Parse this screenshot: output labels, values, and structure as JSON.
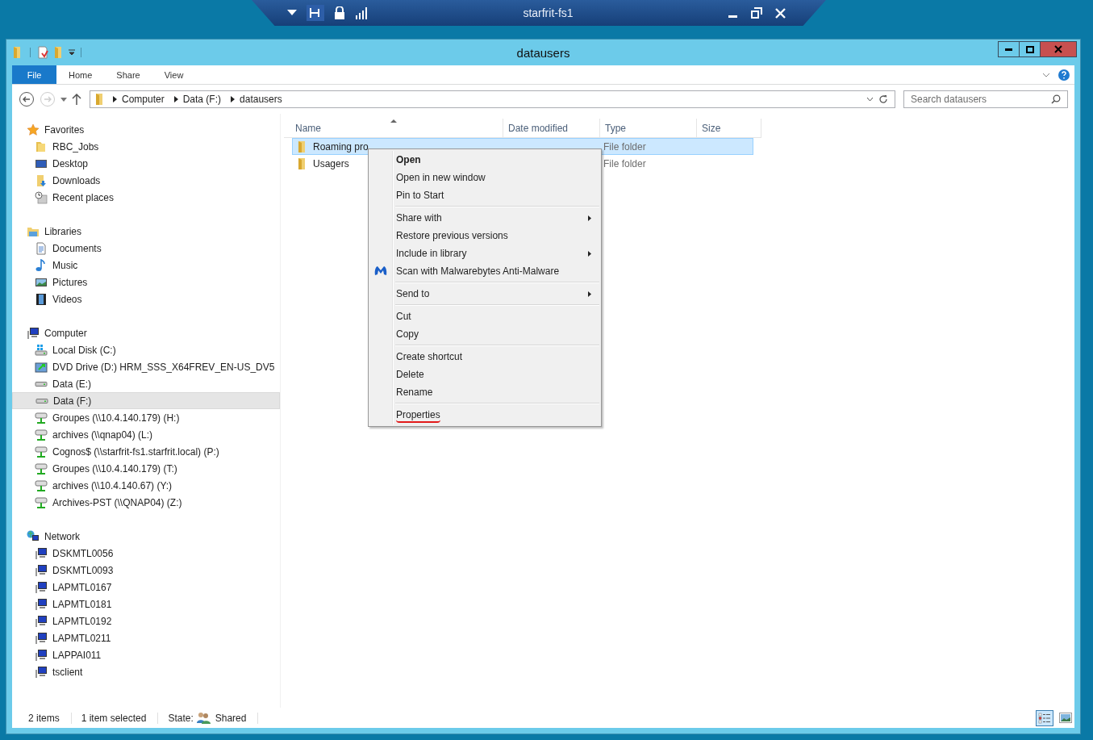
{
  "remote_bar": {
    "title": "starfrit-fs1"
  },
  "window": {
    "title": "datausers"
  },
  "ribbon_tabs": [
    {
      "label": "File",
      "kind": "file"
    },
    {
      "label": "Home",
      "kind": "tab"
    },
    {
      "label": "Share",
      "kind": "tab"
    },
    {
      "label": "View",
      "kind": "tab"
    }
  ],
  "address": {
    "path": [
      "Computer",
      "Data (F:)",
      "datausers"
    ]
  },
  "search": {
    "placeholder": "Search datausers"
  },
  "nav": [
    {
      "label": "Favorites",
      "kind": "star",
      "children": [
        {
          "label": "RBC_Jobs",
          "kind": "folder",
          "selected": false
        },
        {
          "label": "Desktop",
          "kind": "desktop",
          "selected": false
        },
        {
          "label": "Downloads",
          "kind": "download",
          "selected": false
        },
        {
          "label": "Recent places",
          "kind": "recent",
          "selected": false
        }
      ]
    },
    {
      "label": "Libraries",
      "kind": "library",
      "children": [
        {
          "label": "Documents",
          "kind": "document",
          "selected": false
        },
        {
          "label": "Music",
          "kind": "music",
          "selected": false
        },
        {
          "label": "Pictures",
          "kind": "pictures",
          "selected": false
        },
        {
          "label": "Videos",
          "kind": "video",
          "selected": false
        }
      ]
    },
    {
      "label": "Computer",
      "kind": "computer",
      "children": [
        {
          "label": "Local Disk (C:)",
          "kind": "system-disk",
          "selected": false
        },
        {
          "label": "DVD Drive (D:) HRM_SSS_X64FREV_EN-US_DV5",
          "kind": "dvd",
          "selected": false
        },
        {
          "label": "Data (E:)",
          "kind": "disk",
          "selected": false
        },
        {
          "label": "Data (F:)",
          "kind": "disk",
          "selected": true
        },
        {
          "label": "Groupes (\\\\10.4.140.179) (H:)",
          "kind": "share",
          "selected": false
        },
        {
          "label": "archives (\\\\qnap04) (L:)",
          "kind": "share",
          "selected": false
        },
        {
          "label": "Cognos$ (\\\\starfrit-fs1.starfrit.local) (P:)",
          "kind": "share",
          "selected": false
        },
        {
          "label": "Groupes (\\\\10.4.140.179) (T:)",
          "kind": "share",
          "selected": false
        },
        {
          "label": "archives (\\\\10.4.140.67) (Y:)",
          "kind": "share",
          "selected": false
        },
        {
          "label": "Archives-PST (\\\\QNAP04) (Z:)",
          "kind": "share",
          "selected": false
        }
      ]
    },
    {
      "label": "Network",
      "kind": "network",
      "children": [
        {
          "label": "DSKMTL0056",
          "kind": "pc",
          "selected": false
        },
        {
          "label": "DSKMTL0093",
          "kind": "pc",
          "selected": false
        },
        {
          "label": "LAPMTL0167",
          "kind": "pc",
          "selected": false
        },
        {
          "label": "LAPMTL0181",
          "kind": "pc",
          "selected": false
        },
        {
          "label": "LAPMTL0192",
          "kind": "pc",
          "selected": false
        },
        {
          "label": "LAPMTL0211",
          "kind": "pc",
          "selected": false
        },
        {
          "label": "LAPPAI011",
          "kind": "pc",
          "selected": false
        },
        {
          "label": "tsclient",
          "kind": "pc",
          "selected": false
        }
      ]
    }
  ],
  "columns": [
    {
      "label": "Name",
      "sorted": true
    },
    {
      "label": "Date modified",
      "sorted": false
    },
    {
      "label": "Type",
      "sorted": false
    },
    {
      "label": "Size",
      "sorted": false
    }
  ],
  "rows": [
    {
      "name": "Roaming pro",
      "type": "File folder",
      "selected": true
    },
    {
      "name": "Usagers",
      "type": "File folder",
      "selected": false
    }
  ],
  "context_menu": [
    [
      {
        "label": "Open",
        "bold": true,
        "submenu": false
      },
      {
        "label": "Open in new window",
        "bold": false,
        "submenu": false
      },
      {
        "label": "Pin to Start",
        "bold": false,
        "submenu": false
      }
    ],
    [
      {
        "label": "Share with",
        "bold": false,
        "submenu": true
      },
      {
        "label": "Restore previous versions",
        "bold": false,
        "submenu": false
      },
      {
        "label": "Include in library",
        "bold": false,
        "submenu": true
      },
      {
        "label": "Scan with Malwarebytes Anti-Malware",
        "bold": false,
        "submenu": false,
        "kind": "scan"
      }
    ],
    [
      {
        "label": "Send to",
        "bold": false,
        "submenu": true
      }
    ],
    [
      {
        "label": "Cut",
        "bold": false,
        "submenu": false
      },
      {
        "label": "Copy",
        "bold": false,
        "submenu": false
      }
    ],
    [
      {
        "label": "Create shortcut",
        "bold": false,
        "submenu": false
      },
      {
        "label": "Delete",
        "bold": false,
        "submenu": false
      },
      {
        "label": "Rename",
        "bold": false,
        "submenu": false
      }
    ],
    [
      {
        "label": "Properties",
        "bold": false,
        "submenu": false,
        "underlined": true
      }
    ]
  ],
  "status_bar": {
    "count": "2 items",
    "selection": "1 item selected",
    "state_label": "State:",
    "state_value": "Shared"
  },
  "view_buttons": [
    {
      "kind": "details",
      "selected": true
    },
    {
      "kind": "thumbnails",
      "selected": false
    }
  ]
}
